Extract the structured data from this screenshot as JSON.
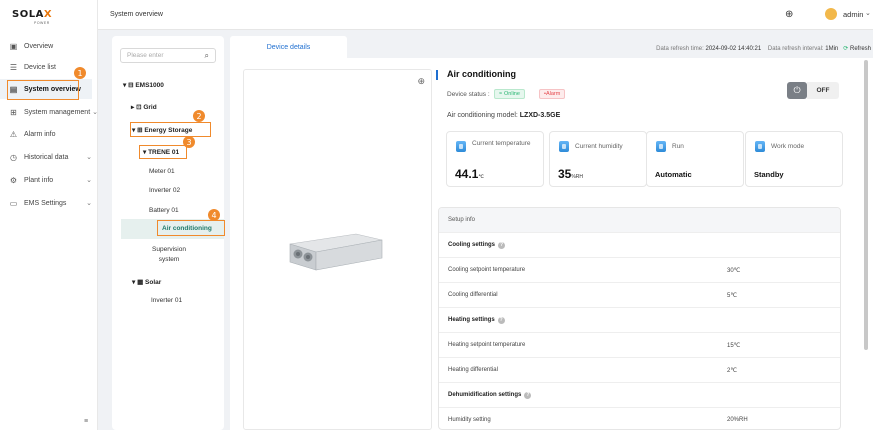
{
  "brand": {
    "logo_pre": "SOLA",
    "logo_x": "X",
    "logo_sub": "POWER"
  },
  "sidebar": {
    "items": [
      {
        "label": "Overview",
        "icon": "dashboard-icon"
      },
      {
        "label": "Device list",
        "icon": "list-icon"
      },
      {
        "label": "System overview",
        "icon": "monitor-icon",
        "active": true
      },
      {
        "label": "System management",
        "icon": "grid-icon",
        "chevron": true
      },
      {
        "label": "Alarm info",
        "icon": "alarm-icon"
      },
      {
        "label": "Historical data",
        "icon": "history-icon",
        "chevron": true
      },
      {
        "label": "Plant info",
        "icon": "gear-icon",
        "chevron": true
      },
      {
        "label": "EMS Settings",
        "icon": "settings-icon",
        "chevron": true
      }
    ],
    "collapse_icon": "≡"
  },
  "header": {
    "title": "System overview",
    "user": "admin"
  },
  "tree": {
    "search_placeholder": "Please enter",
    "root": "EMS1000",
    "grid": "Grid",
    "energy_storage": "Energy Storage",
    "trene": "TRENE 01",
    "meter": "Meter 01",
    "inverter02": "Inverter 02",
    "battery": "Battery 01",
    "aircon": "Air conditioning",
    "supervision1": "Supervision",
    "supervision2": "system",
    "solar": "Solar",
    "inverter01": "Inverter 01"
  },
  "tabs": {
    "device_details": "Device details"
  },
  "refresh": {
    "time_label": "Data refresh time:",
    "time_value": "2024-09-02 14:40:21",
    "interval_label": "Data refresh interval:",
    "interval_value": "1Min",
    "refresh_btn": "Refresh"
  },
  "device": {
    "title": "Air conditioning",
    "status_label": "Device status :",
    "online": "Online",
    "alarm": "Alarm",
    "model_label": "Air conditioning model:",
    "model_value": "LZXD-3.5GE",
    "power_state": "OFF"
  },
  "cards": [
    {
      "label": "Current temperature",
      "value": "44.1",
      "unit": "℃"
    },
    {
      "label": "Current humidity",
      "value": "35",
      "unit": "%RH"
    },
    {
      "label": "Run",
      "value": "Automatic",
      "unit": ""
    },
    {
      "label": "Work mode",
      "value": "Standby",
      "unit": ""
    }
  ],
  "setup": {
    "header": "Setup info",
    "rows": [
      {
        "label": "Cooling settings",
        "value": "",
        "heading": true
      },
      {
        "label": "Cooling setpoint temperature",
        "value": "30℃"
      },
      {
        "label": "Cooling differential",
        "value": "5℃"
      },
      {
        "label": "Heating settings",
        "value": "",
        "heading": true
      },
      {
        "label": "Heating setpoint temperature",
        "value": "15℃"
      },
      {
        "label": "Heating differential",
        "value": "2℃"
      },
      {
        "label": "Dehumidification settings",
        "value": "",
        "heading": true
      },
      {
        "label": "Humidity setting",
        "value": "20%RH"
      }
    ]
  },
  "annotations": [
    "1",
    "2",
    "3",
    "4"
  ],
  "colors": {
    "accent": "#1f6fd0",
    "annotation": "#f08a2c",
    "online": "#2bb673",
    "alarm": "#e5484d"
  }
}
